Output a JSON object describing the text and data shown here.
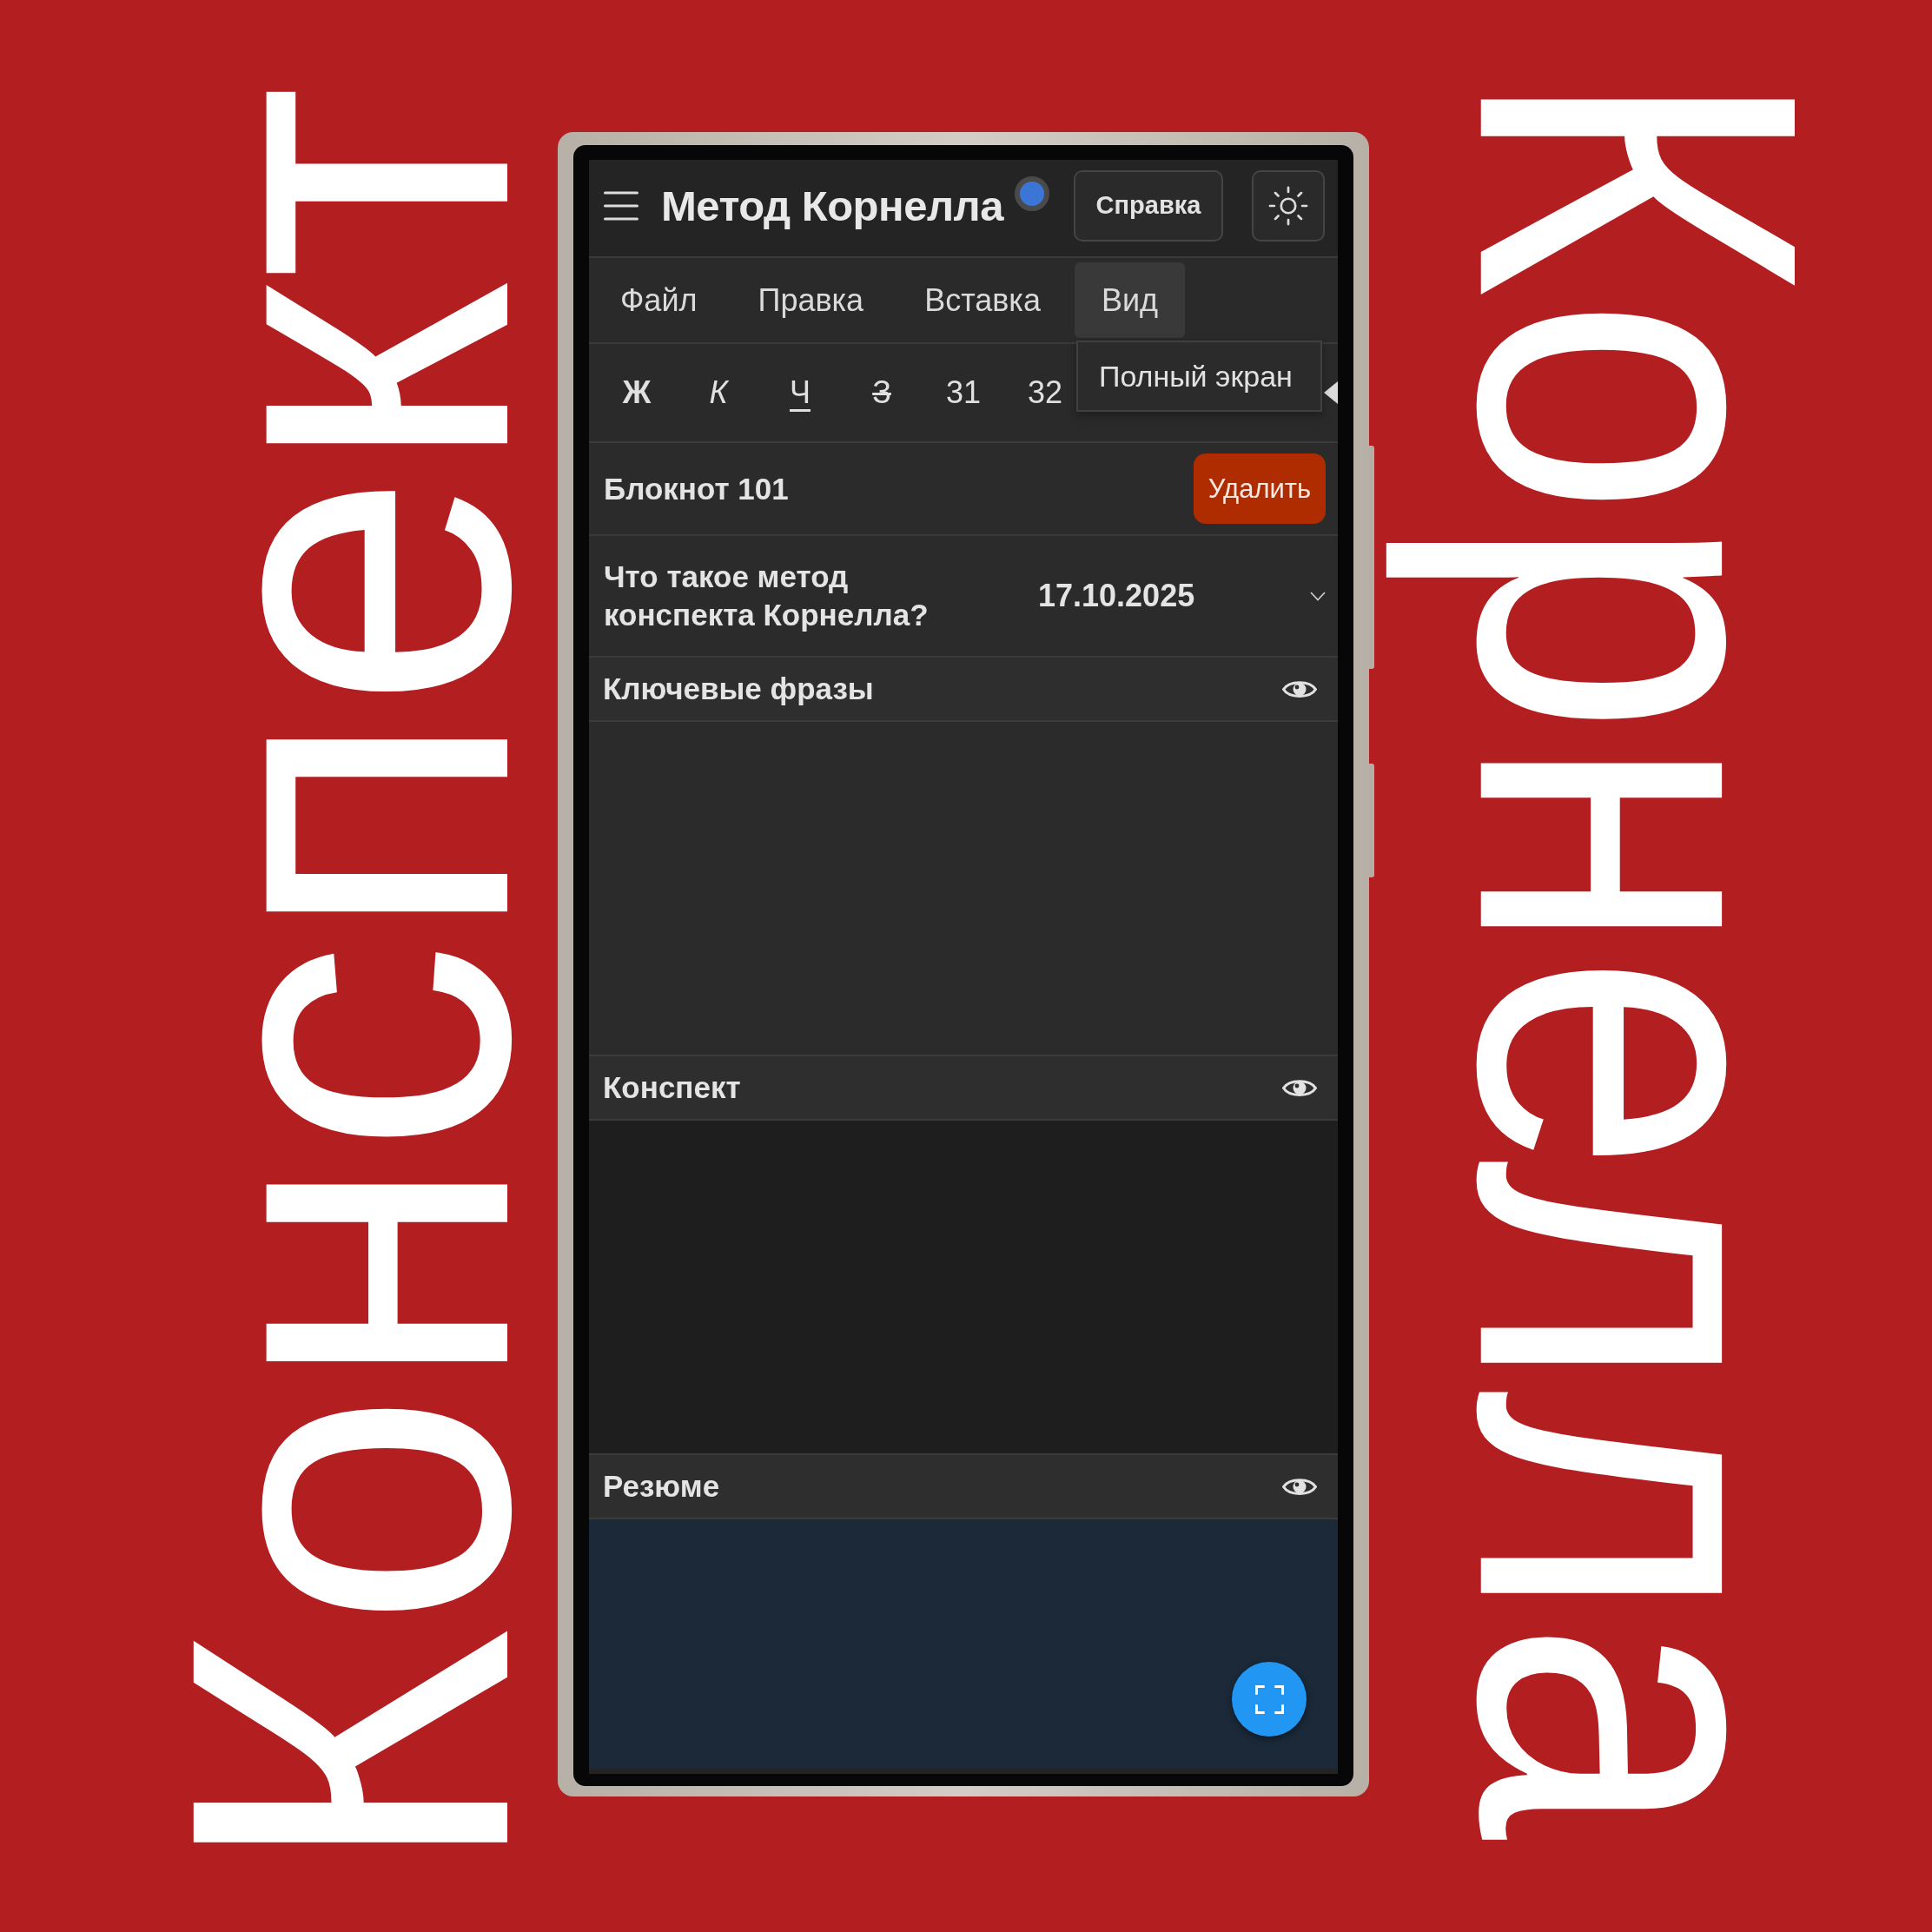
{
  "side_titles": {
    "left": "Конспект",
    "right": "Корнелла"
  },
  "app": {
    "title": "Метод Корнелла",
    "help_button": "Справка",
    "menu": [
      {
        "label": "Файл",
        "selected": false
      },
      {
        "label": "Правка",
        "selected": false
      },
      {
        "label": "Вставка",
        "selected": false
      },
      {
        "label": "Вид",
        "selected": true,
        "items": [
          "Полный экран"
        ]
      }
    ],
    "toolbar": [
      {
        "label": "Ж",
        "kind": "bold"
      },
      {
        "label": "К",
        "kind": "italic"
      },
      {
        "label": "Ч",
        "kind": "underline"
      },
      {
        "label": "З",
        "kind": "strike"
      },
      {
        "label": "31",
        "kind": "plain"
      },
      {
        "label": "32",
        "kind": "plain"
      }
    ],
    "notebook": {
      "title": "Блокнот 101",
      "delete_button": "Удалить"
    },
    "note": {
      "title": "Что такое метод конспекта Корнелла?",
      "date": "17.10.2025"
    },
    "sections": [
      {
        "title": "Ключевые фразы",
        "color": "#2b2b2b"
      },
      {
        "title": "Конспект",
        "color": "#1e1e1e"
      },
      {
        "title": "Резюме",
        "color": "#1b2939"
      }
    ]
  }
}
